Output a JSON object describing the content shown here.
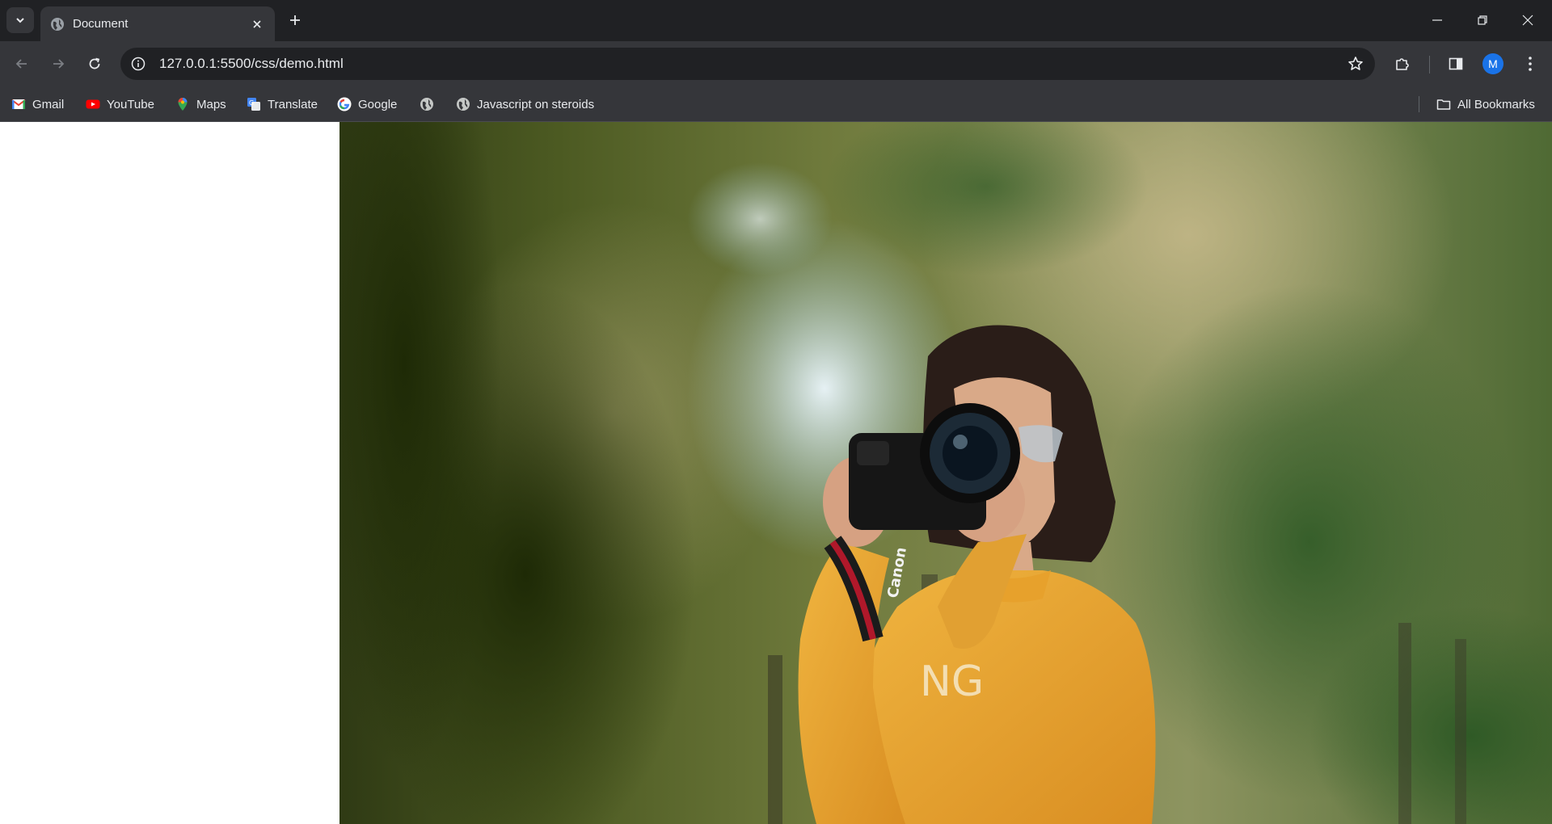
{
  "tab": {
    "title": "Document",
    "favicon": "globe-icon"
  },
  "toolbar": {
    "url": "127.0.0.1:5500/css/demo.html",
    "profile_initial": "M"
  },
  "bookmarks": {
    "items": [
      {
        "label": "Gmail",
        "icon": "gmail-icon"
      },
      {
        "label": "YouTube",
        "icon": "youtube-icon"
      },
      {
        "label": "Maps",
        "icon": "maps-icon"
      },
      {
        "label": "Translate",
        "icon": "translate-icon"
      },
      {
        "label": "Google",
        "icon": "google-icon"
      },
      {
        "label": "",
        "icon": "globe-icon"
      },
      {
        "label": "Javascript on steroids",
        "icon": "globe-icon"
      }
    ],
    "all_bookmarks": "All Bookmarks"
  },
  "content": {
    "image": "photo of a woman in a yellow sweater holding a camera in front of trees",
    "camera_text": "Canon",
    "sweater_text": "NG"
  },
  "colors": {
    "tabstrip": "#202124",
    "toolbar": "#35363a",
    "accent_avatar": "#1a73e8",
    "sweater": "#e8a532"
  }
}
